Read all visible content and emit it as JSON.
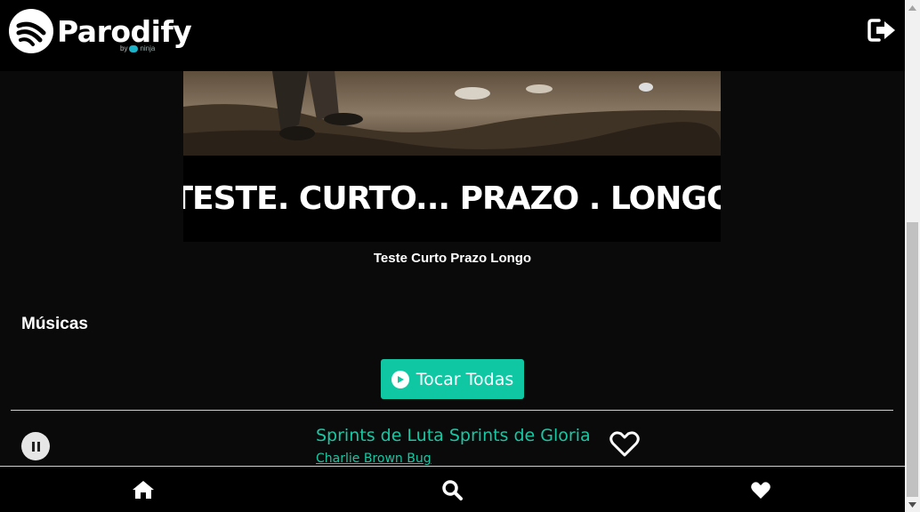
{
  "app": {
    "name": "Parodify",
    "byline_by": "by",
    "byline_brand": "ninja"
  },
  "header": {
    "logout_icon": "sign-out-icon"
  },
  "album": {
    "cover_text": "TESTE. CURTO... PRAZO . LONGO",
    "caption": "Teste Curto Prazo Longo"
  },
  "songs_section": {
    "title": "Músicas",
    "play_all_label": "Tocar Todas"
  },
  "tracks": [
    {
      "title": "Sprints de Luta Sprints de Gloria",
      "artist": "Charlie Brown Bug",
      "state": "playing",
      "favorited": false
    }
  ],
  "bottom_nav": {
    "items": [
      {
        "icon": "home-icon"
      },
      {
        "icon": "search-icon"
      },
      {
        "icon": "heart-icon"
      }
    ]
  },
  "colors": {
    "background": "#0b0a0b",
    "accent": "#0fc7a3",
    "text": "#ffffff"
  }
}
